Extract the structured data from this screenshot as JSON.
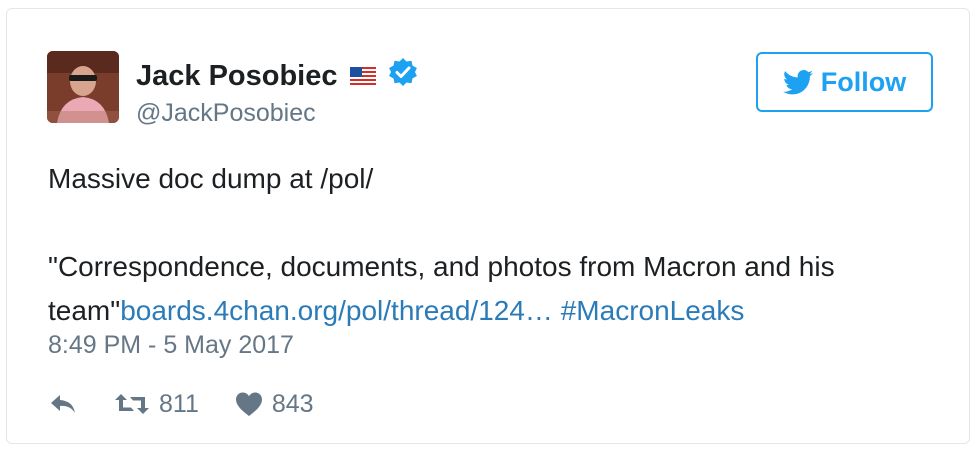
{
  "user": {
    "name": "Jack Posobiec",
    "flag_emoji_icon": "us-flag-icon",
    "verified_icon": "verified-badge-icon",
    "handle": "@JackPosobiec"
  },
  "follow_button": {
    "label": "Follow",
    "icon": "twitter-bird-icon",
    "color": "#1da1f2"
  },
  "tweet": {
    "line1": "Massive doc dump at /pol/",
    "quote_start": "\"Correspondence, documents, and photos from Macron and his team\"",
    "link": "boards.4chan.org/pol/thread/124…",
    "hashtag": "#MacronLeaks",
    "link_color": "#2b7bb9"
  },
  "timestamp": "8:49 PM - 5 May 2017",
  "actions": {
    "retweet_count": "811",
    "like_count": "843"
  }
}
